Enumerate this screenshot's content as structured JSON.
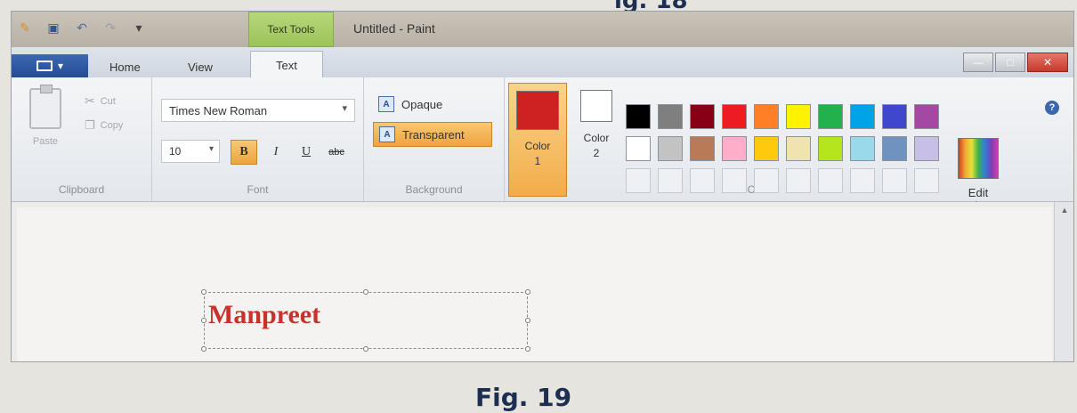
{
  "page": {
    "top_caption": "ig. 18",
    "caption": "Fig. 19"
  },
  "qat": {
    "icons": [
      "paint-app-icon",
      "save-icon",
      "undo-icon",
      "redo-icon",
      "customize-dropdown-icon"
    ]
  },
  "title": {
    "context_tab": "Text Tools",
    "window_title": "Untitled - Paint"
  },
  "window_controls": {
    "minimize": "—",
    "maximize": "□",
    "close": "✕"
  },
  "tabs": {
    "file_glyph": "▾",
    "home": "Home",
    "view": "View",
    "text": "Text"
  },
  "clipboard": {
    "paste": "Paste",
    "cut": "Cut",
    "copy": "Copy",
    "label": "Clipboard"
  },
  "font": {
    "family": "Times New Roman",
    "size": "10",
    "bold": "B",
    "italic": "I",
    "underline": "U",
    "strike": "abc",
    "label": "Font"
  },
  "background": {
    "opaque": "Opaque",
    "transparent": "Transparent",
    "label": "Background"
  },
  "colors": {
    "color1_label": "Color",
    "color1_num": "1",
    "color1_hex": "#cc2222",
    "color2_label": "Color",
    "color2_num": "2",
    "color2_hex": "#ffffff",
    "palette": [
      "#000000",
      "#7f7f7f",
      "#880015",
      "#ed1c24",
      "#ff7f27",
      "#fff200",
      "#22b14c",
      "#00a2e8",
      "#3f48cc",
      "#a349a4",
      "#ffffff",
      "#c3c3c3",
      "#b97a57",
      "#ffaec9",
      "#ffc90e",
      "#efe4b0",
      "#b5e61d",
      "#99d9ea",
      "#7092be",
      "#c8bfe7",
      "",
      "",
      "",
      "",
      "",
      "",
      "",
      "",
      "",
      ""
    ],
    "edit": "Edit colors",
    "label": "Colors"
  },
  "canvas": {
    "text": "Manpreet",
    "text_color": "#c7332b"
  }
}
